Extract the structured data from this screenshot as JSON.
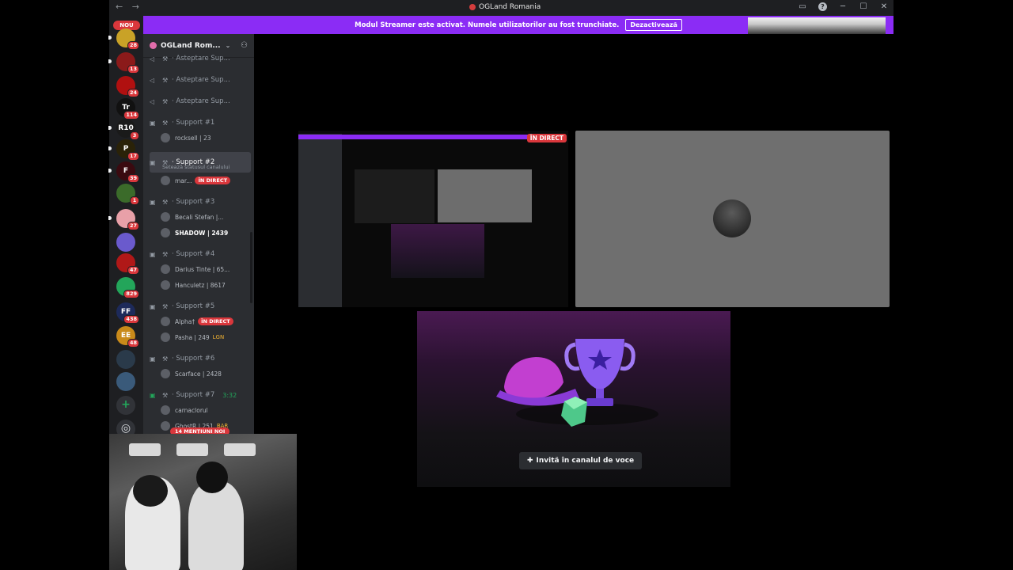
{
  "window": {
    "title": "OGLand Romania",
    "nav_back": "←",
    "nav_forward": "→",
    "inbox_icon": "inbox-icon",
    "help_label": "?",
    "minimize_label": "─",
    "maximize_label": "☐",
    "close_label": "✕"
  },
  "streamer_bar": {
    "message": "Modul Streamer este activat. Numele utilizatorilor au fost trunchiate.",
    "button_label": "Dezactivează"
  },
  "guild_bar": {
    "new_label": "NOU",
    "guilds": [
      {
        "initials": "",
        "badge": "28",
        "color": "#c9a227"
      },
      {
        "initials": "",
        "badge": "13",
        "color": "#8b1a1a"
      },
      {
        "initials": "",
        "badge": "24",
        "color": "#b01010"
      },
      {
        "initials": "Tr",
        "badge": "114",
        "color": "#111111"
      },
      {
        "initials": "R10",
        "badge": "3",
        "color": "#1a1a1a"
      },
      {
        "initials": "P",
        "badge": "17",
        "color": "#2a2208"
      },
      {
        "initials": "F",
        "badge": "39",
        "color": "#3a0a10"
      },
      {
        "initials": "",
        "badge": "1",
        "color": "#3b6b2a"
      },
      {
        "initials": "",
        "badge": "27",
        "color": "#e8a0a8"
      },
      {
        "initials": "",
        "badge": "",
        "color": "#6a5acd"
      },
      {
        "initials": "",
        "badge": "47",
        "color": "#b01818"
      },
      {
        "initials": "",
        "badge": "829",
        "color": "#23a55a"
      },
      {
        "initials": "FF",
        "badge": "438",
        "color": "#1d2a5a"
      },
      {
        "initials": "EE",
        "badge": "48",
        "color": "#c98a1a"
      },
      {
        "initials": "",
        "badge": "",
        "color": "#2a3a4a"
      },
      {
        "initials": "",
        "badge": "",
        "color": "#3a5a7a"
      }
    ],
    "add_label": "+",
    "discover_label": "◎"
  },
  "server": {
    "name": "OGLand Rom...",
    "channels": [
      {
        "name": "Asteptare Sup...",
        "type": "voice-muted"
      },
      {
        "name": "Asteptare Sup...",
        "type": "voice-muted"
      },
      {
        "name": "Asteptare Sup...",
        "type": "voice-muted"
      },
      {
        "name": "Support #1",
        "type": "locked",
        "users": [
          {
            "name": "rocksell | 23",
            "extra": ""
          }
        ]
      },
      {
        "name": "Support #2",
        "type": "locked",
        "status": "Setează statusul canalului",
        "users": [
          {
            "name": "mar...",
            "live": "ÎN DIRECT"
          }
        ]
      },
      {
        "name": "Support #3",
        "type": "locked",
        "users": [
          {
            "name": "Becali Stefan |...",
            "extra": ""
          },
          {
            "name": "SHADOW | 2439",
            "extra": ""
          }
        ]
      },
      {
        "name": "Support #4",
        "type": "locked",
        "users": [
          {
            "name": "Darius Tinte | 65...",
            "extra": ""
          },
          {
            "name": "Hanculetz | 8617",
            "extra": ""
          }
        ]
      },
      {
        "name": "Support #5",
        "type": "locked",
        "users": [
          {
            "name": "Alpha†",
            "live": "ÎN DIRECT"
          },
          {
            "name": "Pasha | 249",
            "extra": "LGN"
          }
        ]
      },
      {
        "name": "Support #6",
        "type": "locked",
        "users": [
          {
            "name": "Scarface | 2428",
            "extra": ""
          }
        ]
      },
      {
        "name": "Support #7",
        "type": "locked-green",
        "time": "3:32",
        "users": [
          {
            "name": "carnaclorul",
            "extra": ""
          },
          {
            "name": "GhostR | 251",
            "extra": "BAR"
          }
        ]
      }
    ],
    "mentions_label": "14 MENȚIUNI NOI"
  },
  "stream": {
    "live_label": "ÎN DIRECT"
  },
  "invite": {
    "button_label": "Invită în canalul de voce"
  }
}
